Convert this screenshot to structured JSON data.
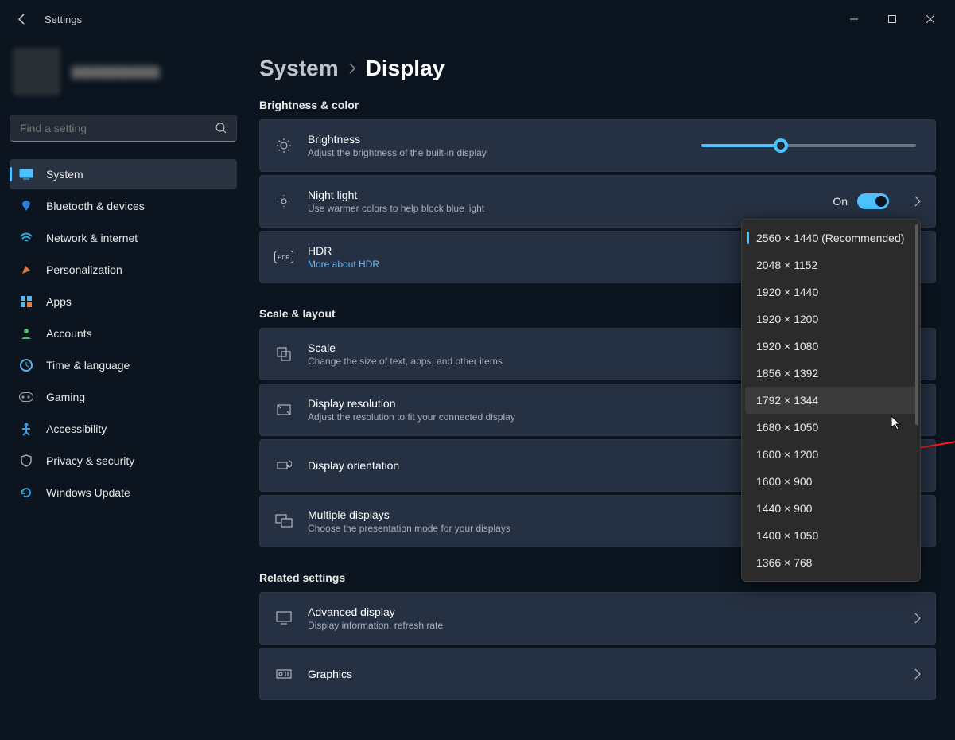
{
  "window": {
    "title": "Settings",
    "search_placeholder": "Find a setting"
  },
  "sidebar": [
    {
      "label": "System",
      "active": true
    },
    {
      "label": "Bluetooth & devices"
    },
    {
      "label": "Network & internet"
    },
    {
      "label": "Personalization"
    },
    {
      "label": "Apps"
    },
    {
      "label": "Accounts"
    },
    {
      "label": "Time & language"
    },
    {
      "label": "Gaming"
    },
    {
      "label": "Accessibility"
    },
    {
      "label": "Privacy & security"
    },
    {
      "label": "Windows Update"
    }
  ],
  "breadcrumb": {
    "parent": "System",
    "current": "Display"
  },
  "sections": {
    "brightness_heading": "Brightness & color",
    "scale_heading": "Scale & layout",
    "related_heading": "Related settings",
    "brightness": {
      "title": "Brightness",
      "sub": "Adjust the brightness of the built-in display",
      "value_pct": 37
    },
    "night_light": {
      "title": "Night light",
      "sub": "Use warmer colors to help block blue light",
      "state_label": "On"
    },
    "hdr": {
      "title": "HDR",
      "link": "More about HDR"
    },
    "scale": {
      "title": "Scale",
      "sub": "Change the size of text, apps, and other items"
    },
    "resolution": {
      "title": "Display resolution",
      "sub": "Adjust the resolution to fit your connected display"
    },
    "orientation": {
      "title": "Display orientation"
    },
    "multiple": {
      "title": "Multiple displays",
      "sub": "Choose the presentation mode for your displays"
    },
    "adv": {
      "title": "Advanced display",
      "sub": "Display information, refresh rate"
    },
    "graphics": {
      "title": "Graphics"
    }
  },
  "resolution_dropdown": {
    "selected_index": 0,
    "hover_index": 6,
    "options": [
      "2560 × 1440 (Recommended)",
      "2048 × 1152",
      "1920 × 1440",
      "1920 × 1200",
      "1920 × 1080",
      "1856 × 1392",
      "1792 × 1344",
      "1680 × 1050",
      "1600 × 1200",
      "1600 × 900",
      "1440 × 900",
      "1400 × 1050",
      "1366 × 768"
    ]
  }
}
